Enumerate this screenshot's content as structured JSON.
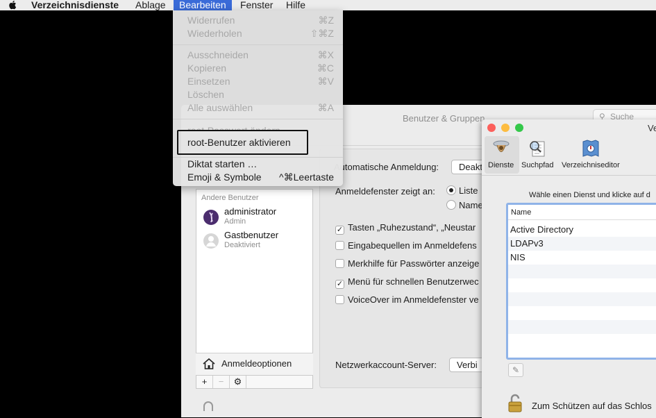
{
  "menubar": {
    "app_name": "Verzeichnisdienste",
    "items": [
      "Ablage",
      "Bearbeiten",
      "Fenster",
      "Hilfe"
    ]
  },
  "edit_menu": {
    "items": [
      {
        "label": "Widerrufen",
        "shortcut": "⌘Z",
        "enabled": false
      },
      {
        "label": "Wiederholen",
        "shortcut": "⇧⌘Z",
        "enabled": false
      },
      {
        "label": "Ausschneiden",
        "shortcut": "⌘X",
        "enabled": false
      },
      {
        "label": "Kopieren",
        "shortcut": "⌘C",
        "enabled": false
      },
      {
        "label": "Einsetzen",
        "shortcut": "⌘V",
        "enabled": false
      },
      {
        "label": "Löschen",
        "shortcut": "",
        "enabled": false
      },
      {
        "label": "Alle auswählen",
        "shortcut": "⌘A",
        "enabled": false
      },
      {
        "label": "root-Passwort ändern …",
        "shortcut": "",
        "enabled": false
      },
      {
        "label": "root-Benutzer aktivieren",
        "shortcut": "",
        "enabled": true
      },
      {
        "label": "Diktat starten …",
        "shortcut": "",
        "enabled": true
      },
      {
        "label": "Emoji & Symbole",
        "shortcut": "^⌘Leertaste",
        "enabled": true
      }
    ]
  },
  "users_window": {
    "title": "Benutzer & Gruppen",
    "search_placeholder": "Suche",
    "other_users_label": "Andere Benutzer",
    "users": [
      {
        "name": "administrator",
        "role": "Admin"
      },
      {
        "name": "Gastbenutzer",
        "role": "Deaktiviert"
      }
    ],
    "login_options_label": "Anmeldeoptionen",
    "list_buttons": [
      "+",
      "−",
      "⚙"
    ],
    "auto_login_label": "Automatische Anmeldung:",
    "auto_login_value": "Deakt",
    "login_window_label": "Anmeldefenster zeigt an:",
    "radio_list": "Liste",
    "radio_name": "Name",
    "checkboxes": [
      {
        "label": "Tasten „Ruhezustand“, „Neustar",
        "checked": true
      },
      {
        "label": "Eingabequellen im Anmeldefens",
        "checked": false
      },
      {
        "label": "Merkhilfe für Passwörter anzeige",
        "checked": false
      },
      {
        "label": "Menü für schnellen Benutzerwec",
        "checked": true
      },
      {
        "label": "VoiceOver im Anmeldefenster ve",
        "checked": false
      }
    ],
    "network_server_label": "Netzwerkaccount-Server:",
    "network_server_button": "Verbi"
  },
  "directory_window": {
    "title": "Ve",
    "toolbar": [
      {
        "label": "Dienste",
        "icon": "services-icon"
      },
      {
        "label": "Suchpfad",
        "icon": "search-path-icon"
      },
      {
        "label": "Verzeichniseditor",
        "icon": "directory-editor-icon"
      }
    ],
    "hint": "Wähle einen Dienst und klicke auf d",
    "table_header": "Name",
    "services": [
      "Active Directory",
      "LDAPv3",
      "NIS"
    ],
    "lock_text": "Zum Schützen auf das Schlos"
  },
  "colors": {
    "menu_highlight": "#3a6bd8",
    "close": "#fc605c",
    "minimize": "#fdbc40",
    "zoom": "#34c84a",
    "table_focus": "#8fb3e8"
  }
}
